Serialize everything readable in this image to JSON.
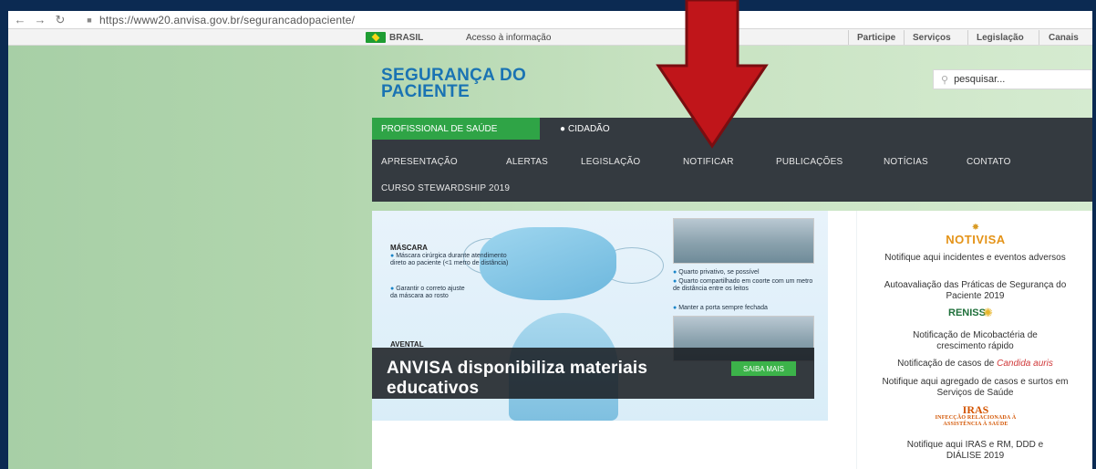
{
  "browser": {
    "url": "https://www20.anvisa.gov.br/segurancadopaciente/"
  },
  "govbar": {
    "brasil": "BRASIL",
    "acesso": "Acesso à informação",
    "links": [
      "Participe",
      "Serviços",
      "Legislação",
      "Canais"
    ]
  },
  "header": {
    "title_line1": "SEGURANÇA DO",
    "title_line2": "PACIENTE",
    "search_placeholder": "pesquisar..."
  },
  "nav": {
    "audience": [
      "PROFISSIONAL DE SAÚDE",
      "CIDADÃO"
    ],
    "menu": [
      "APRESENTAÇÃO",
      "ALERTAS",
      "LEGISLAÇÃO",
      "NOTIFICAR",
      "PUBLICAÇÕES",
      "NOTÍCIAS",
      "CONTATO"
    ],
    "menu_row2": "CURSO STEWARDSHIP 2019"
  },
  "banner": {
    "mascara_title": "MÁSCARA",
    "mascara_1": "Máscara cirúrgica durante atendimento direto ao paciente (<1 metro de distância)",
    "mascara_2": "Garantir o correto ajuste da máscara ao rosto",
    "avental_title": "AVENTAL",
    "quarto_1": "Quarto privativo, se possível",
    "quarto_2": "Quarto compartilhado em coorte com um metro de distância entre os leitos",
    "quarto_3": "Manter a porta sempre fechada",
    "caption": "ANVISA disponibiliza materiais educativos",
    "saiba_mais": "SAIBA MAIS"
  },
  "sidebar": {
    "notivisa": "NOTIVISA",
    "notifique_incidentes": "Notifique aqui incidentes e eventos adversos",
    "autoavaliacao": "Autoavaliação das Práticas de Segurança do Paciente 2019",
    "reniss": "RENISS",
    "micobacteria": "Notificação de Micobactéria de crescimento rápido",
    "candida_prefix": "Notificação de casos de ",
    "candida_name": "Candida auris",
    "agregado": "Notifique aqui agregado de casos e surtos em Serviços de Saúde",
    "iras_title": "IRAS",
    "iras_sub1": "INFECÇÃO RELACIONADA À",
    "iras_sub2": "ASSISTÊNCIA À SAÚDE",
    "iras_link": "Notifique aqui IRAS e RM, DDD e DIÁLISE 2019"
  },
  "colors": {
    "title_blue": "#1a73b3",
    "nav_dark": "#343a40",
    "audience_green": "#2fa446",
    "arrow_red": "#c0151a",
    "notivisa_orange": "#e49318",
    "iras_orange": "#d35400"
  },
  "icons": [
    "back-arrow-icon",
    "forward-arrow-icon",
    "reload-icon",
    "lock-icon",
    "brazil-flag-icon",
    "search-icon",
    "user-icon",
    "red-down-arrow"
  ]
}
